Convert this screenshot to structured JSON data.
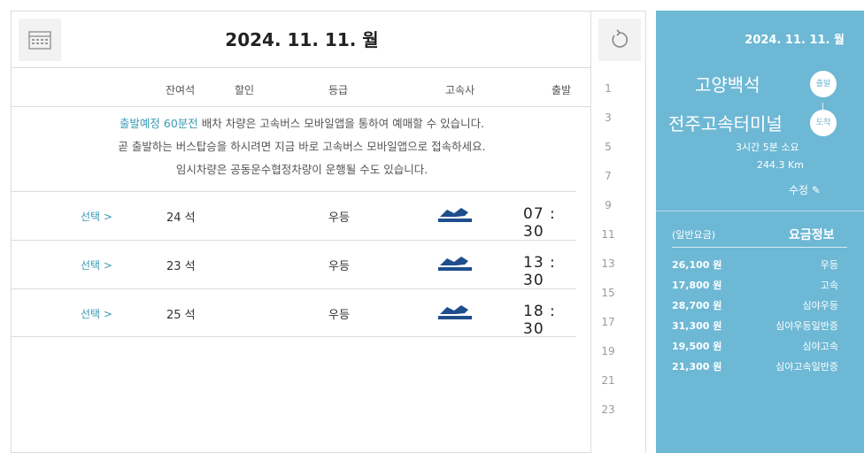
{
  "header": {
    "date_title": "2024. 11. 11. 월"
  },
  "columns": {
    "departure": "출발",
    "company": "고속사",
    "grade": "등급",
    "discount": "할인",
    "remaining_seats": "잔여석"
  },
  "notice": {
    "line1_highlight": "출발예정 60분전",
    "line1_rest": "배차 차량은 고속버스 모바일앱을 통하여 예매할 수 있습니다.",
    "line2": "곧 출발하는 버스탑승을 하시려면 지금 바로 고속버스 모바일앱으로 접속하세요.",
    "line3": "임시차량은 공동운수협정차량이 운행될 수도 있습니다."
  },
  "schedules": [
    {
      "time": "07 : 30",
      "grade": "우등",
      "seats": "24 석",
      "select": "선택 >"
    },
    {
      "time": "13 : 30",
      "grade": "우등",
      "seats": "23 석",
      "select": "선택 >"
    },
    {
      "time": "18 : 30",
      "grade": "우등",
      "seats": "25 석",
      "select": "선택 >"
    }
  ],
  "hour_list": [
    "1",
    "3",
    "5",
    "7",
    "9",
    "11",
    "13",
    "15",
    "17",
    "19",
    "21",
    "23"
  ],
  "info": {
    "date": "2024. 11. 11. 월",
    "departure_tag": "출발",
    "arrival_tag": "도착",
    "departure": "고양백석",
    "arrival": "전주고속터미널",
    "duration": "3시간 5분 소요",
    "distance": "244.3 Km",
    "edit": "수정",
    "fare_title": "요금정보",
    "fare_note": "(일반요금)",
    "fares": [
      {
        "label": "우등",
        "value": "26,100 원"
      },
      {
        "label": "고속",
        "value": "17,800 원"
      },
      {
        "label": "심야우등",
        "value": "28,700 원"
      },
      {
        "label": "심야우등일반증",
        "value": "31,300 원"
      },
      {
        "label": "심야고속",
        "value": "19,500 원"
      },
      {
        "label": "심야고속일반증",
        "value": "21,300 원"
      }
    ]
  },
  "colors": {
    "accent": "#6db8d5",
    "link": "#3a9ab5"
  }
}
